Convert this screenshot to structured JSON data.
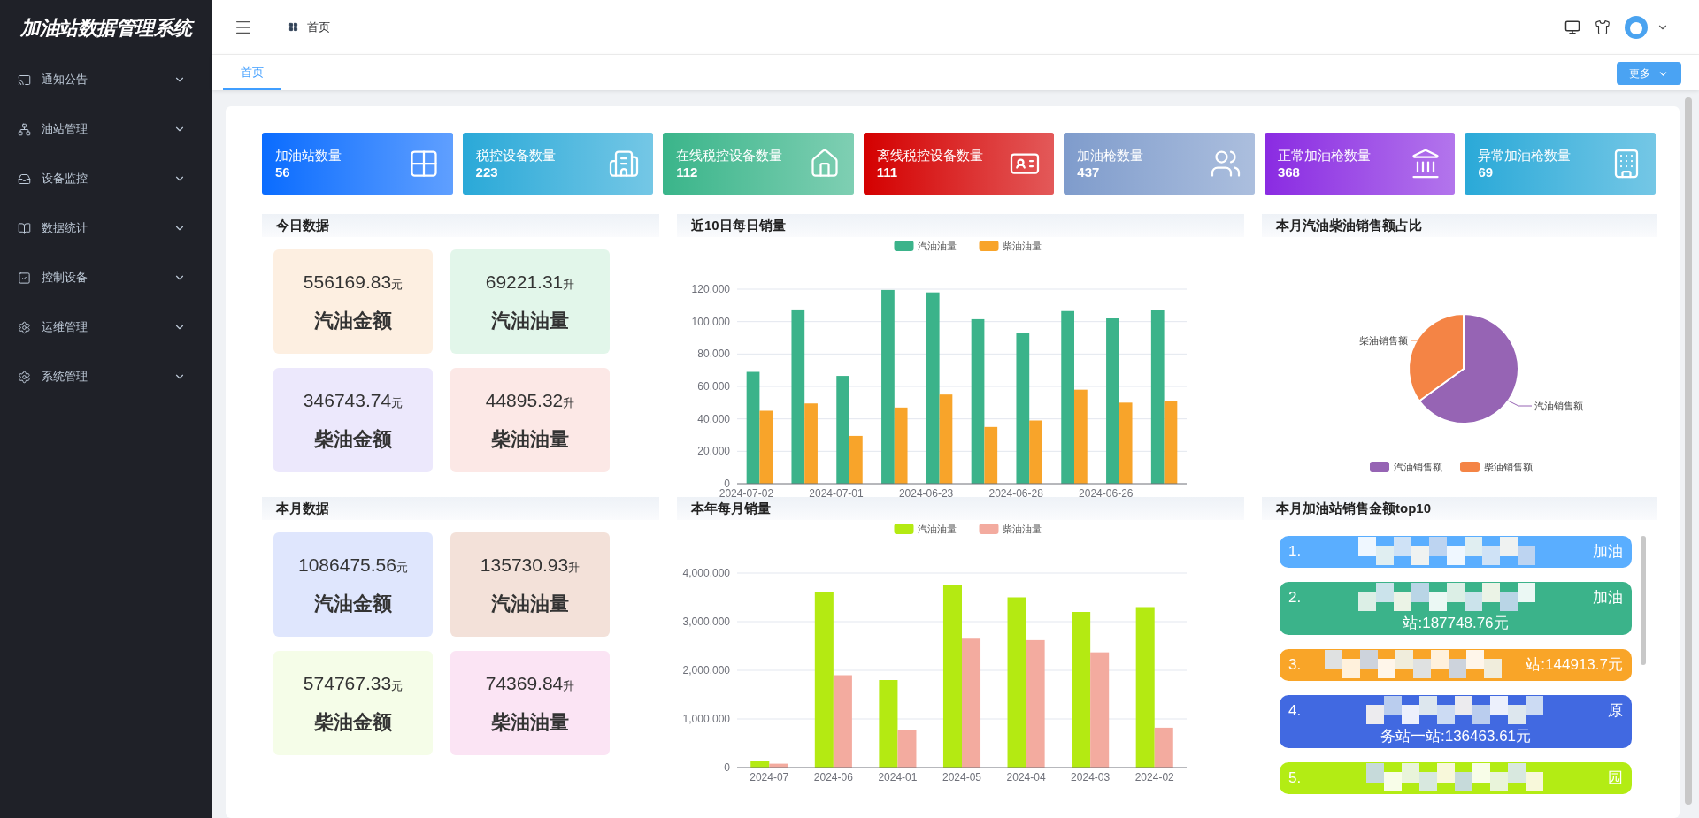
{
  "app": {
    "logo": "加油站数据管理系统"
  },
  "sidebar": {
    "items": [
      {
        "label": "通知公告",
        "expanded": false
      },
      {
        "label": "油站管理",
        "expanded": false
      },
      {
        "label": "设备监控",
        "expanded": false
      },
      {
        "label": "数据统计",
        "expanded": false
      },
      {
        "label": "控制设备",
        "expanded": false
      },
      {
        "label": "运维管理",
        "expanded": false
      },
      {
        "label": "系统管理",
        "expanded": false
      }
    ]
  },
  "header": {
    "breadcrumb": "首页"
  },
  "tabs": [
    {
      "label": "首页",
      "selected": true
    }
  ],
  "more_button": "更多",
  "stat_cards": [
    {
      "label": "加油站数量",
      "value": "56",
      "color": "#0a6cff"
    },
    {
      "label": "税控设备数量",
      "value": "223",
      "color": "#2aa9d8"
    },
    {
      "label": "在线税控设备数量",
      "value": "112",
      "color": "#3ab58a"
    },
    {
      "label": "离线税控设备数量",
      "value": "111",
      "color": "#d40000"
    },
    {
      "label": "加油枪数量",
      "value": "437",
      "color": "#7f9ccc"
    },
    {
      "label": "正常加油枪数量",
      "value": "368",
      "color": "#8a2be2"
    },
    {
      "label": "异常加油枪数量",
      "value": "69",
      "color": "#2aa9d8"
    }
  ],
  "today": {
    "title": "今日数据",
    "tiles": [
      {
        "value": "556169.83",
        "unit": "元",
        "label": "汽油金额",
        "color": "#fdefe1"
      },
      {
        "value": "69221.31",
        "unit": "升",
        "label": "汽油油量",
        "color": "#e2f6ea"
      },
      {
        "value": "346743.74",
        "unit": "元",
        "label": "柴油金额",
        "color": "#ece8fc"
      },
      {
        "value": "44895.32",
        "unit": "升",
        "label": "柴油油量",
        "color": "#fce8e6"
      }
    ]
  },
  "month": {
    "title": "本月数据",
    "tiles": [
      {
        "value": "1086475.56",
        "unit": "元",
        "label": "汽油金额",
        "color": "#dfe6fd"
      },
      {
        "value": "135730.93",
        "unit": "升",
        "label": "汽油油量",
        "color": "#f3e1d9"
      },
      {
        "value": "574767.33",
        "unit": "元",
        "label": "柴油金额",
        "color": "#f5fde8"
      },
      {
        "value": "74369.84",
        "unit": "升",
        "label": "柴油油量",
        "color": "#fbe4f4"
      }
    ]
  },
  "daily_chart": {
    "title": "近10日每日销量",
    "chart_data": {
      "type": "bar",
      "categories": [
        "2024-07-02",
        null,
        "2024-07-01",
        null,
        "2024-06-23",
        null,
        "2024-06-28",
        null,
        "2024-06-26",
        null
      ],
      "series": [
        {
          "name": "汽油油量",
          "color": "#3bb38a",
          "values": [
            69000,
            107500,
            66500,
            119500,
            118000,
            101500,
            93000,
            106500,
            102000,
            107000
          ]
        },
        {
          "name": "柴油油量",
          "color": "#f8a42a",
          "values": [
            45000,
            49500,
            29500,
            47000,
            55000,
            35000,
            39000,
            58000,
            50000,
            51000
          ]
        }
      ],
      "grid": true,
      "legend": "top",
      "ylim": [
        0,
        120000
      ],
      "yticks": [
        {
          "value": 0,
          "label": "0"
        },
        {
          "value": 20000,
          "label": "20,000"
        },
        {
          "value": 40000,
          "label": "40,000"
        },
        {
          "value": 60000,
          "label": "60,000"
        },
        {
          "value": 80000,
          "label": "80,000"
        },
        {
          "value": 100000,
          "label": "100,000"
        },
        {
          "value": 120000,
          "label": "120,000"
        }
      ]
    }
  },
  "monthly_chart": {
    "title": "本年每月销量",
    "chart_data": {
      "type": "bar",
      "categories": [
        "2024-07",
        "2024-06",
        "2024-01",
        "2024-05",
        "2024-04",
        "2024-03",
        "2024-02"
      ],
      "series": [
        {
          "name": "汽油油量",
          "color": "#b4ea12",
          "values": [
            140000,
            3600000,
            1800000,
            3750000,
            3500000,
            3200000,
            3300000
          ]
        },
        {
          "name": "柴油油量",
          "color": "#f3ab9f",
          "values": [
            80000,
            1900000,
            770000,
            2650000,
            2620000,
            2370000,
            820000
          ]
        }
      ],
      "grid": true,
      "legend": "top",
      "ylim": [
        0,
        4000000
      ],
      "yticks": [
        {
          "value": 0,
          "label": "0"
        },
        {
          "value": 1000000,
          "label": "1,000,000"
        },
        {
          "value": 2000000,
          "label": "2,000,000"
        },
        {
          "value": 3000000,
          "label": "3,000,000"
        },
        {
          "value": 4000000,
          "label": "4,000,000"
        }
      ]
    }
  },
  "share_chart": {
    "title": "本月汽油柴油销售额占比",
    "slices": [
      {
        "label": "汽油销售额",
        "color": "#9664b4"
      },
      {
        "label": "柴油销售额",
        "color": "#f48445"
      }
    ],
    "legend": [
      {
        "label": "汽油销售额",
        "color": "#9664b4"
      },
      {
        "label": "柴油销售额",
        "color": "#f48445"
      }
    ]
  },
  "top10": {
    "title": "本月加油站销售金额top10",
    "items": [
      {
        "rank": "1.",
        "tail": "加油",
        "color": "#5aaeff"
      },
      {
        "rank": "2.",
        "tail": "加油",
        "line2": "站:187748.76元",
        "color": "#3bb38a"
      },
      {
        "rank": "3.",
        "tail": "站:144913.7元",
        "color": "#f9a528"
      },
      {
        "rank": "4.",
        "tail": "原",
        "line2": "务站一站:136463.61元",
        "color": "#4169e1"
      },
      {
        "rank": "5.",
        "tail": "园",
        "color": "#b3ec14"
      }
    ]
  }
}
